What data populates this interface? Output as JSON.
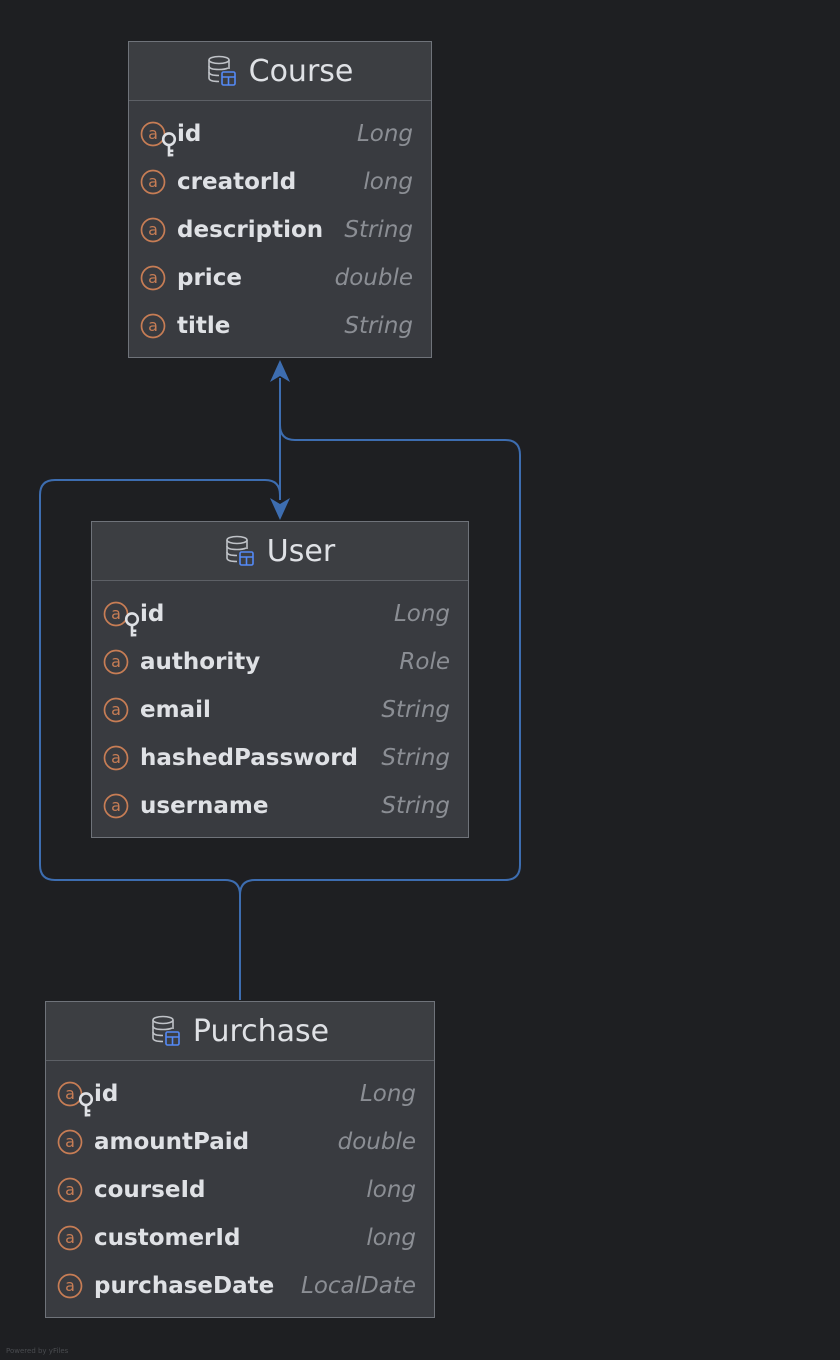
{
  "entities": {
    "course": {
      "title": "Course",
      "fields": [
        {
          "name": "id",
          "type": "Long",
          "primary_key": true
        },
        {
          "name": "creatorId",
          "type": "long",
          "primary_key": false
        },
        {
          "name": "description",
          "type": "String",
          "primary_key": false
        },
        {
          "name": "price",
          "type": "double",
          "primary_key": false
        },
        {
          "name": "title",
          "type": "String",
          "primary_key": false
        }
      ]
    },
    "user": {
      "title": "User",
      "fields": [
        {
          "name": "id",
          "type": "Long",
          "primary_key": true
        },
        {
          "name": "authority",
          "type": "Role",
          "primary_key": false
        },
        {
          "name": "email",
          "type": "String",
          "primary_key": false
        },
        {
          "name": "hashedPassword",
          "type": "String",
          "primary_key": false
        },
        {
          "name": "username",
          "type": "String",
          "primary_key": false
        }
      ]
    },
    "purchase": {
      "title": "Purchase",
      "fields": [
        {
          "name": "id",
          "type": "Long",
          "primary_key": true
        },
        {
          "name": "amountPaid",
          "type": "double",
          "primary_key": false
        },
        {
          "name": "courseId",
          "type": "long",
          "primary_key": false
        },
        {
          "name": "customerId",
          "type": "long",
          "primary_key": false
        },
        {
          "name": "purchaseDate",
          "type": "LocalDate",
          "primary_key": false
        }
      ]
    }
  },
  "icons": {
    "entity": "database-table-icon",
    "field": "attribute-icon",
    "primary_key": "key-icon"
  },
  "colors": {
    "background": "#1e1f22",
    "entity_body": "#393b40",
    "connector": "#3574f0",
    "attribute_icon": "#c77d55",
    "table_badge": "#548af7"
  },
  "footer": {
    "note": "Powered by yFiles"
  }
}
